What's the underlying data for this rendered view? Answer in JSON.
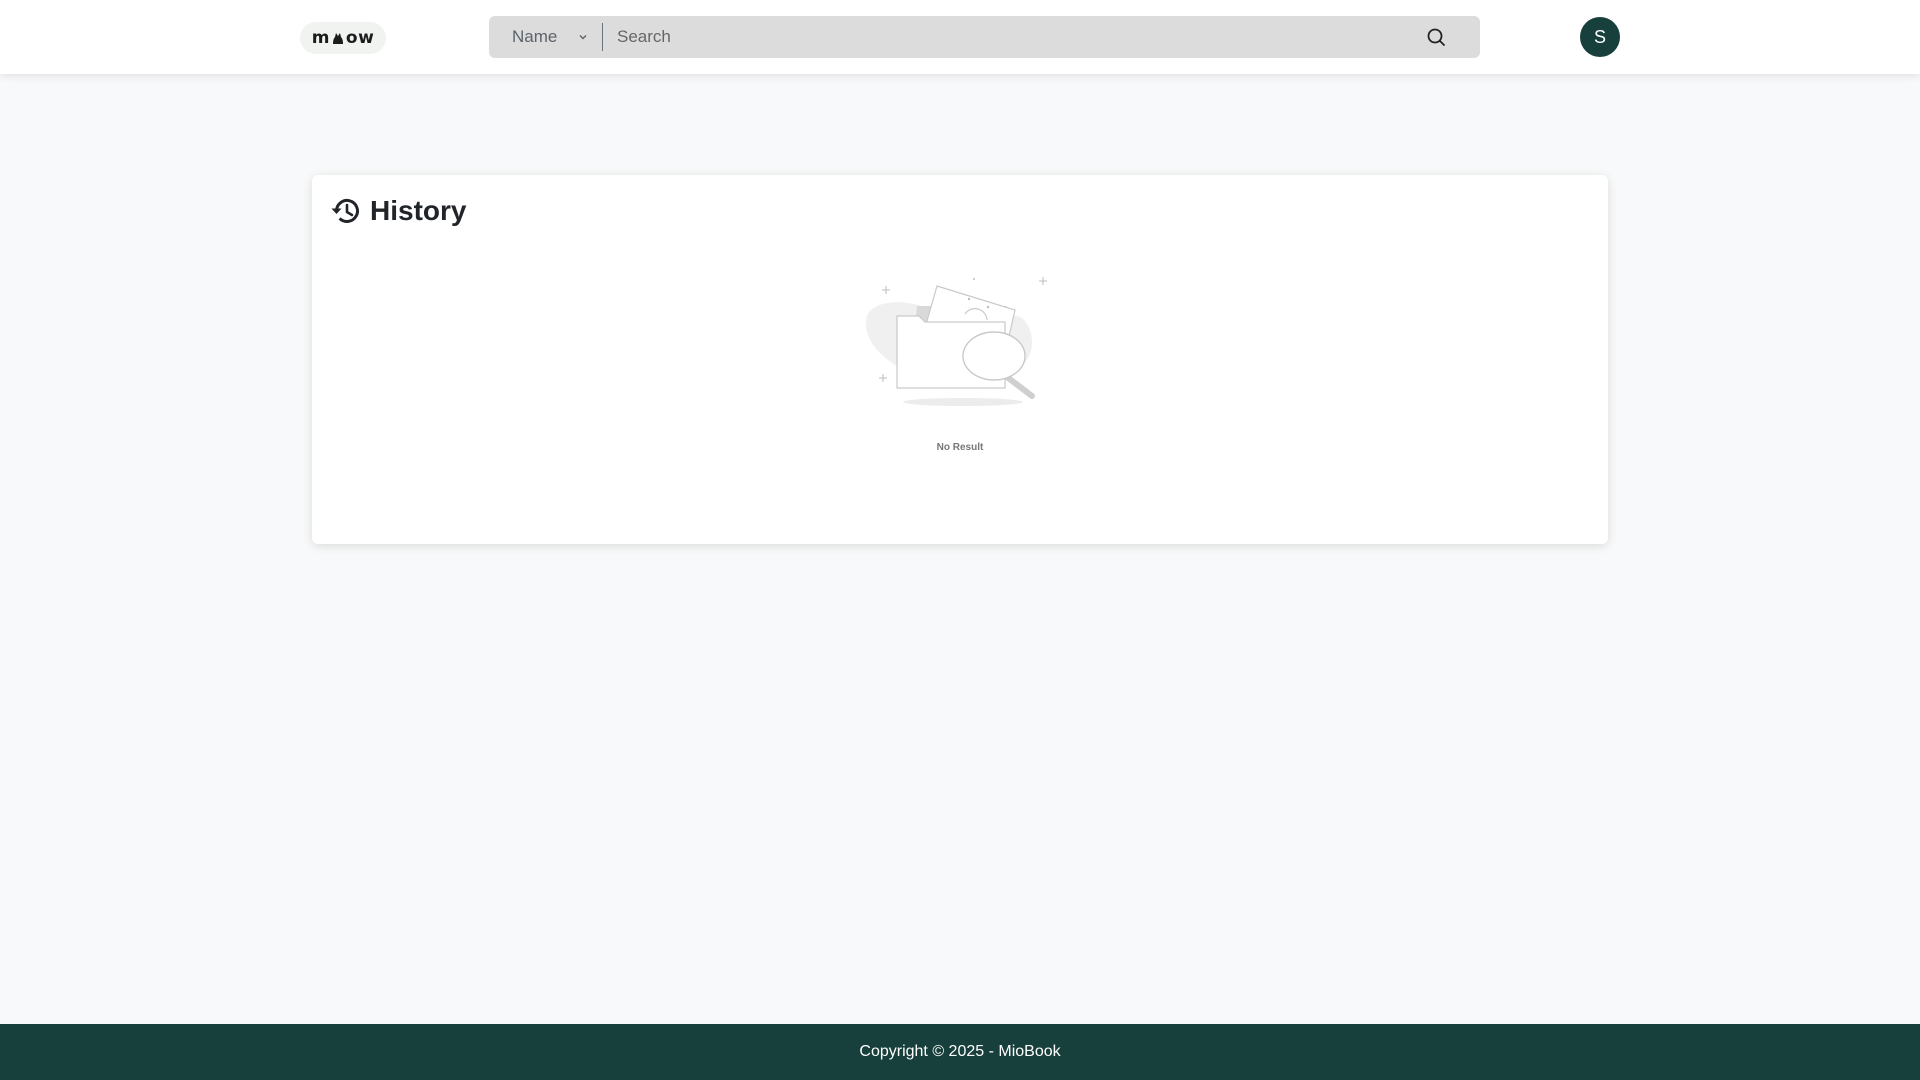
{
  "header": {
    "logo_text": "meow",
    "search": {
      "filter_selected": "Name",
      "placeholder": "Search"
    },
    "avatar_initial": "S"
  },
  "history": {
    "title": "History",
    "empty_text": "No Result"
  },
  "footer": {
    "copyright": "Copyright © 2025 - MioBook"
  },
  "colors": {
    "brand_dark": "#173f3b",
    "search_bg": "#dcdcdc",
    "page_bg": "#f8f9fa"
  }
}
